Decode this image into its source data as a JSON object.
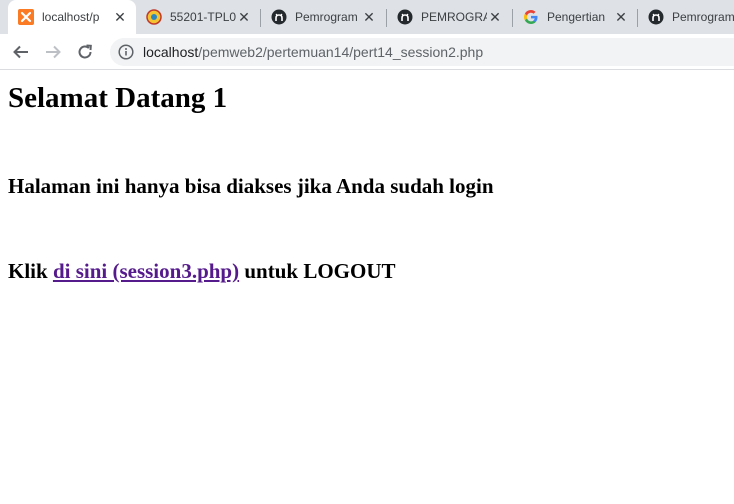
{
  "tabs": [
    {
      "title": "localhost/p",
      "icon": "xampp-icon",
      "active": true
    },
    {
      "title": "55201-TPL0",
      "icon": "university-logo-icon",
      "active": false
    },
    {
      "title": "Pemrogram",
      "icon": "github-icon",
      "active": false
    },
    {
      "title": "PEMROGRA",
      "icon": "github-icon",
      "active": false
    },
    {
      "title": "Pengertian",
      "icon": "google-icon",
      "active": false
    },
    {
      "title": "Pemrogram",
      "icon": "github-icon",
      "active": false
    }
  ],
  "address": {
    "host": "localhost",
    "path": "/pemweb2/pertemuan14/pert14_session2.php"
  },
  "page": {
    "heading": "Selamat Datang 1",
    "message": "Halaman ini hanya bisa diakses jika Anda sudah login",
    "logout_prefix": "Klik ",
    "logout_link": "di sini (session3.php)",
    "logout_suffix": " untuk LOGOUT"
  },
  "colors": {
    "tabbar_bg": "#dee1e6",
    "link_visited": "#551a8b"
  }
}
